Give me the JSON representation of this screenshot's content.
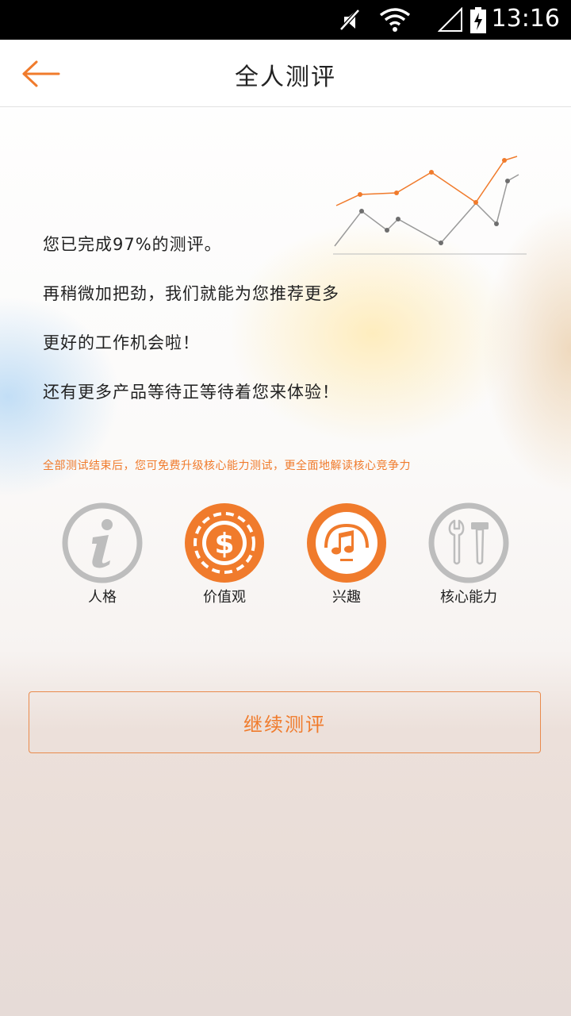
{
  "status_bar": {
    "time": "13:16",
    "icons": [
      "mute-icon",
      "wifi-icon",
      "signal-icon",
      "battery-charging-icon"
    ]
  },
  "header": {
    "title": "全人测评",
    "back_icon": "back-arrow-icon"
  },
  "colors": {
    "accent": "#f07b2c",
    "inactive": "#bdbdbd",
    "text": "#222222"
  },
  "messages": {
    "line1": "您已完成97%的测评。",
    "line2": "再稍微加把劲，我们就能为您推荐更多",
    "line3": "更好的工作机会啦！",
    "line4": "还有更多产品等待正等待着您来体验！"
  },
  "note": "全部测试结束后，您可免费升级核心能力测试，更全面地解读核心竞争力",
  "categories": [
    {
      "label": "人格",
      "icon": "info-icon",
      "active": false
    },
    {
      "label": "价值观",
      "icon": "dollar-coin-icon",
      "active": true
    },
    {
      "label": "兴趣",
      "icon": "music-icon",
      "active": true
    },
    {
      "label": "核心能力",
      "icon": "tools-icon",
      "active": false
    }
  ],
  "continue_button": {
    "label": "继续测评"
  }
}
